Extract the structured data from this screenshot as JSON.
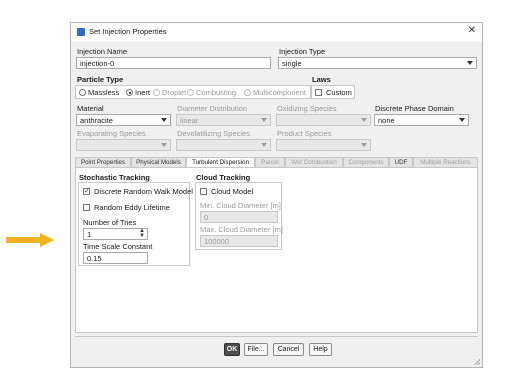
{
  "window": {
    "title": "Set Injection Properties"
  },
  "injection_name": {
    "label": "Injection Name",
    "value": "injection-0"
  },
  "injection_type": {
    "label": "Injection Type",
    "value": "single"
  },
  "particle_type": {
    "label": "Particle Type",
    "options": [
      "Massless",
      "Inert",
      "Droplet",
      "Combusting",
      "Multicomponent"
    ],
    "selected": "Inert"
  },
  "laws": {
    "label": "Laws",
    "custom_label": "Custom"
  },
  "material": {
    "label": "Material",
    "value": "anthracite"
  },
  "diameter_distribution": {
    "label": "Diameter Distribution",
    "value": "linear"
  },
  "oxidizing_species": {
    "label": "Oxidizing Species",
    "value": ""
  },
  "discrete_phase_domain": {
    "label": "Discrete Phase Domain",
    "value": "none"
  },
  "evaporating_species": {
    "label": "Evaporating Species",
    "value": ""
  },
  "devolatilizing_species": {
    "label": "Devolatilizing Species",
    "value": ""
  },
  "product_species": {
    "label": "Product Species",
    "value": ""
  },
  "tabs": [
    "Point Properties",
    "Physical Models",
    "Turbulent Dispersion",
    "Parcel",
    "Wet Combustion",
    "Components",
    "UDF",
    "Multiple Reactions"
  ],
  "active_tab": "Turbulent Dispersion",
  "stochastic": {
    "title": "Stochastic Tracking",
    "drw_label": "Discrete Random Walk Model",
    "drw_checked": true,
    "rel_label": "Random Eddy Lifetime",
    "rel_checked": false,
    "tries_label": "Number of Tries",
    "tries_value": "1",
    "tsc_label": "Time Scale Constant",
    "tsc_value": "0.15"
  },
  "cloud": {
    "title": "Cloud Tracking",
    "model_label": "Cloud Model",
    "min_label": "Min. Cloud Diameter [m]",
    "min_value": "0",
    "max_label": "Max. Cloud Diameter [m]",
    "max_value": "100000"
  },
  "buttons": {
    "ok": "OK",
    "file": "File...",
    "cancel": "Cancel",
    "help": "Help"
  },
  "colors": {
    "indicator_arrow": "#f0b323",
    "ok_button": "#4d4d4d",
    "app_icon": "#2f6fbf"
  }
}
